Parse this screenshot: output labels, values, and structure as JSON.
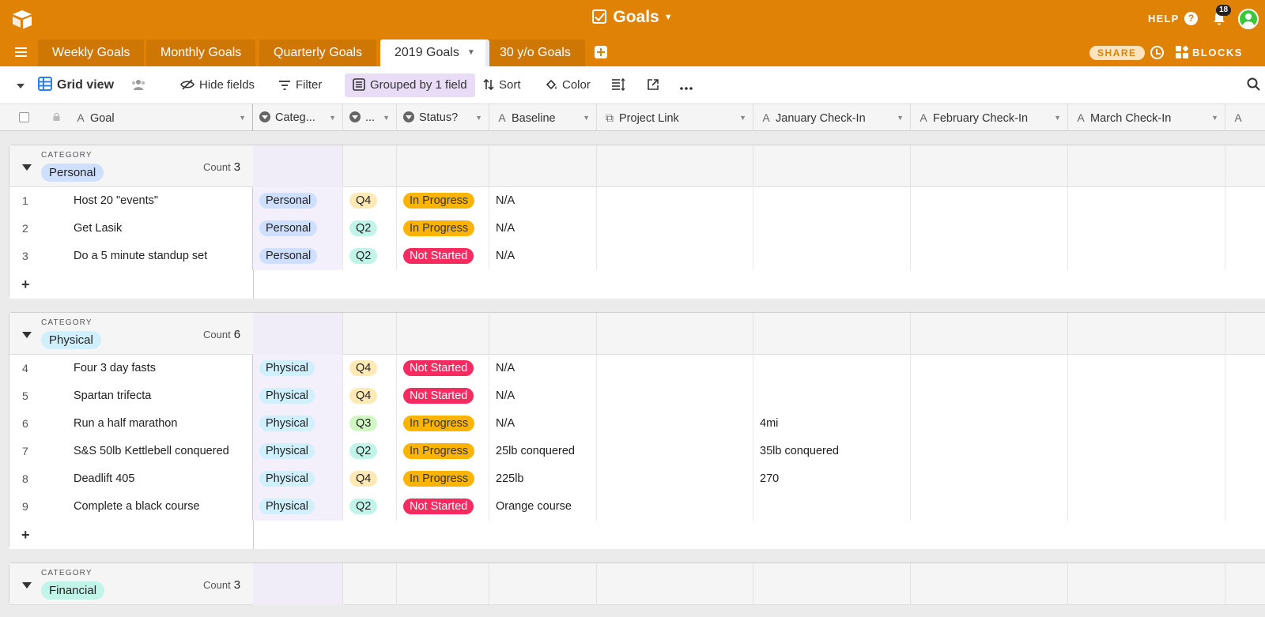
{
  "app": {
    "base_title": "Goals",
    "help_label": "HELP",
    "notification_count": "18",
    "share_label": "SHARE",
    "blocks_label": "BLOCKS"
  },
  "tabs": [
    {
      "label": "Weekly Goals"
    },
    {
      "label": "Monthly Goals"
    },
    {
      "label": "Quarterly Goals"
    },
    {
      "label": "2019 Goals",
      "active": true
    },
    {
      "label": "30 y/o Goals"
    }
  ],
  "toolbar": {
    "view_name": "Grid view",
    "hide_fields": "Hide fields",
    "filter": "Filter",
    "grouped": "Grouped by 1 field",
    "sort": "Sort",
    "color": "Color"
  },
  "columns": {
    "goal": "Goal",
    "category": "Categ...",
    "quarter": "...",
    "status": "Status?",
    "baseline": "Baseline",
    "project_link": "Project Link",
    "january": "January Check-In",
    "february": "February Check-In",
    "march": "March Check-In"
  },
  "colors": {
    "header_orange": "#e08206",
    "personal": "#cfdfff",
    "physical": "#d0f0fd",
    "financial": "#c2f5e9",
    "q4": "#ffeab6",
    "q2": "#c2f5e9",
    "q3": "#d1f7c4",
    "in_progress": "#fcb400",
    "not_started": "#f82b60"
  },
  "groups": [
    {
      "label": "CATEGORY",
      "name": "Personal",
      "count_label": "Count",
      "count": "3",
      "rows": [
        {
          "num": "1",
          "goal": "Host 20 \"events\"",
          "category": "Personal",
          "quarter": "Q4",
          "status": "In Progress",
          "baseline": "N/A",
          "jan": ""
        },
        {
          "num": "2",
          "goal": "Get Lasik",
          "category": "Personal",
          "quarter": "Q2",
          "status": "In Progress",
          "baseline": "N/A",
          "jan": ""
        },
        {
          "num": "3",
          "goal": "Do a 5 minute standup set",
          "category": "Personal",
          "quarter": "Q2",
          "status": "Not Started",
          "baseline": "N/A",
          "jan": ""
        }
      ]
    },
    {
      "label": "CATEGORY",
      "name": "Physical",
      "count_label": "Count",
      "count": "6",
      "rows": [
        {
          "num": "4",
          "goal": "Four 3 day fasts",
          "category": "Physical",
          "quarter": "Q4",
          "status": "Not Started",
          "baseline": "N/A",
          "jan": ""
        },
        {
          "num": "5",
          "goal": "Spartan trifecta",
          "category": "Physical",
          "quarter": "Q4",
          "status": "Not Started",
          "baseline": "N/A",
          "jan": ""
        },
        {
          "num": "6",
          "goal": "Run a half marathon",
          "category": "Physical",
          "quarter": "Q3",
          "status": "In Progress",
          "baseline": "N/A",
          "jan": "4mi"
        },
        {
          "num": "7",
          "goal": "S&S 50lb Kettlebell conquered",
          "category": "Physical",
          "quarter": "Q2",
          "status": "In Progress",
          "baseline": "25lb conquered",
          "jan": "35lb conquered"
        },
        {
          "num": "8",
          "goal": "Deadlift 405",
          "category": "Physical",
          "quarter": "Q4",
          "status": "In Progress",
          "baseline": "225lb",
          "jan": "270"
        },
        {
          "num": "9",
          "goal": "Complete a black course",
          "category": "Physical",
          "quarter": "Q2",
          "status": "Not Started",
          "baseline": "Orange course",
          "jan": ""
        }
      ]
    },
    {
      "label": "CATEGORY",
      "name": "Financial",
      "count_label": "Count",
      "count": "3",
      "rows": []
    }
  ]
}
